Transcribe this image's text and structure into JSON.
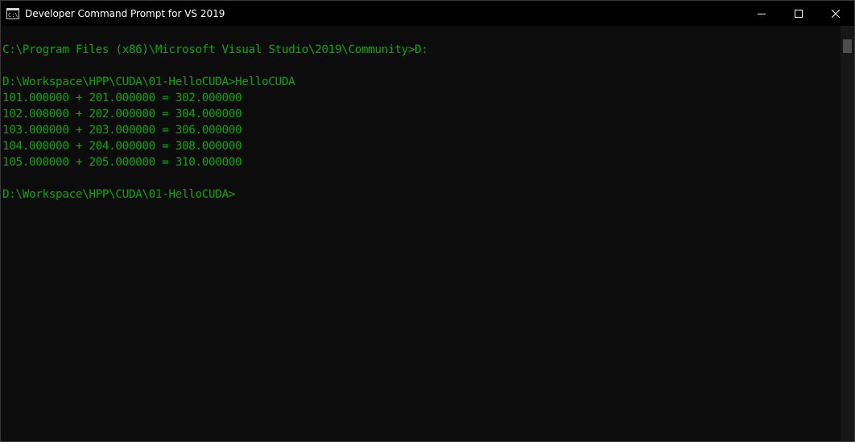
{
  "window": {
    "title": "Developer Command Prompt for VS 2019",
    "app_icon": "cmd-icon",
    "controls": [
      "minimize-icon",
      "maximize-icon",
      "close-icon"
    ]
  },
  "colors": {
    "console_text": "#13a10e",
    "console_background": "#0c0c0c",
    "titlebar": "#000000"
  },
  "console": {
    "lines": [
      "C:\\Program Files (x86)\\Microsoft Visual Studio\\2019\\Community>D:",
      "",
      "D:\\Workspace\\HPP\\CUDA\\01-HelloCUDA>HelloCUDA",
      "101.000000 + 201.000000 = 302.000000",
      "102.000000 + 202.000000 = 304.000000",
      "103.000000 + 203.000000 = 306.000000",
      "104.000000 + 204.000000 = 308.000000",
      "105.000000 + 205.000000 = 310.000000",
      "",
      "D:\\Workspace\\HPP\\CUDA\\01-HelloCUDA>"
    ]
  }
}
